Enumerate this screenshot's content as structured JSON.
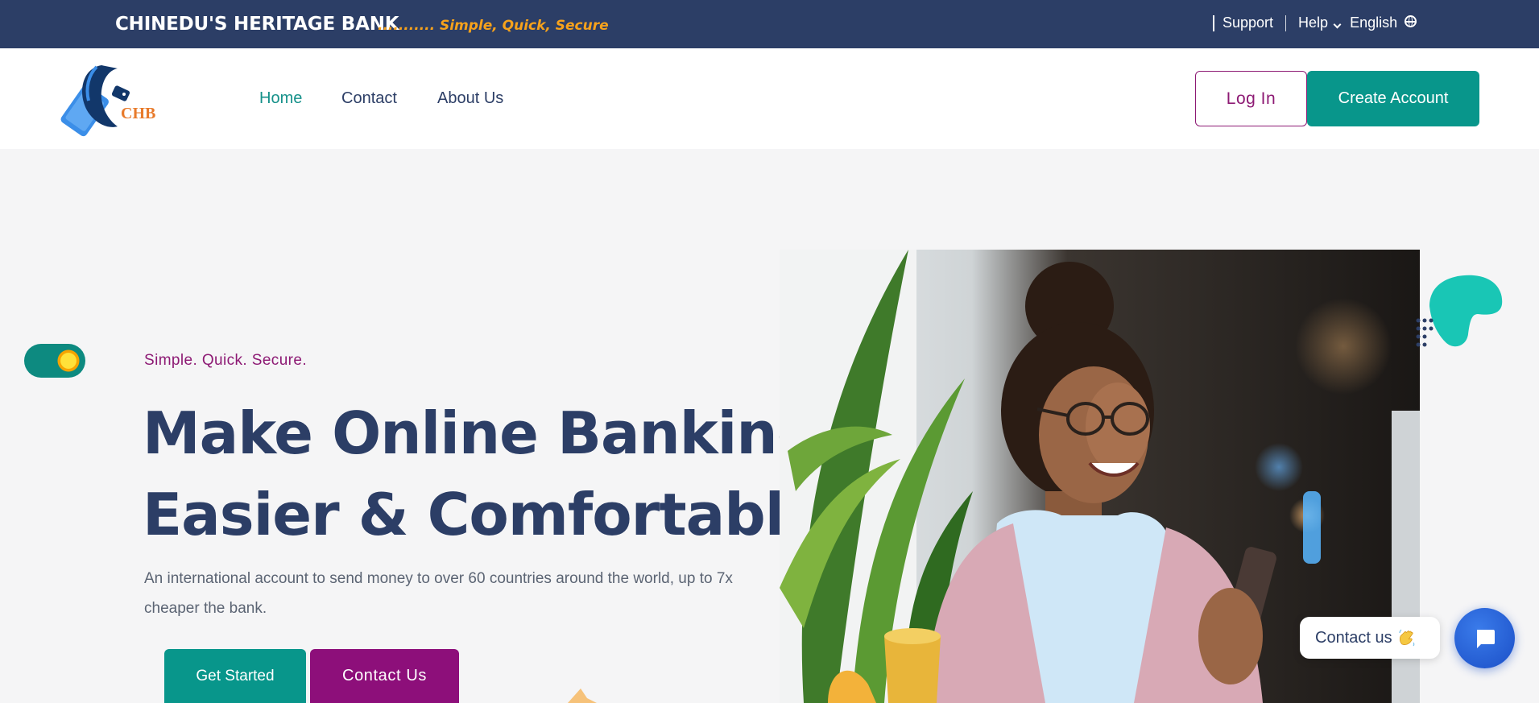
{
  "topbar": {
    "brand": "CHINEDU'S HERITAGE BANK",
    "tagline": "........... Simple, Quick, Secure",
    "support": "Support",
    "help": "Help",
    "language": "English"
  },
  "logo": {
    "text": "CHB"
  },
  "nav": {
    "links": [
      {
        "label": "Home",
        "active": true
      },
      {
        "label": "Contact",
        "active": false
      },
      {
        "label": "About Us",
        "active": false
      }
    ],
    "login_label": "Log In",
    "create_label": "Create Account"
  },
  "hero": {
    "theme_toggle_on": true,
    "eyebrow": "Simple. Quick. Secure.",
    "headline_line1": "Make Online Banking",
    "headline_line2": "Easier & Comfortable",
    "lead": "An international account to send money to over 60 countries around the world, up to 7x cheaper the bank.",
    "get_started_label": "Get Started",
    "contact_us_label": "Contact Us"
  },
  "widget": {
    "contact_label": "Contact us"
  },
  "icons": {
    "globe": "globe-icon",
    "help_chevron": "chevron-down-icon",
    "theme_toggle": "sun-icon",
    "wave": "waving-hand-icon",
    "chat": "chat-bubble-icon"
  },
  "colors": {
    "topbar": "#2c3e66",
    "tagline": "#f7a21b",
    "teal": "#08968b",
    "magenta": "#8d0f7a",
    "heading": "#2c3e66",
    "chat": "#1b4fc7"
  }
}
